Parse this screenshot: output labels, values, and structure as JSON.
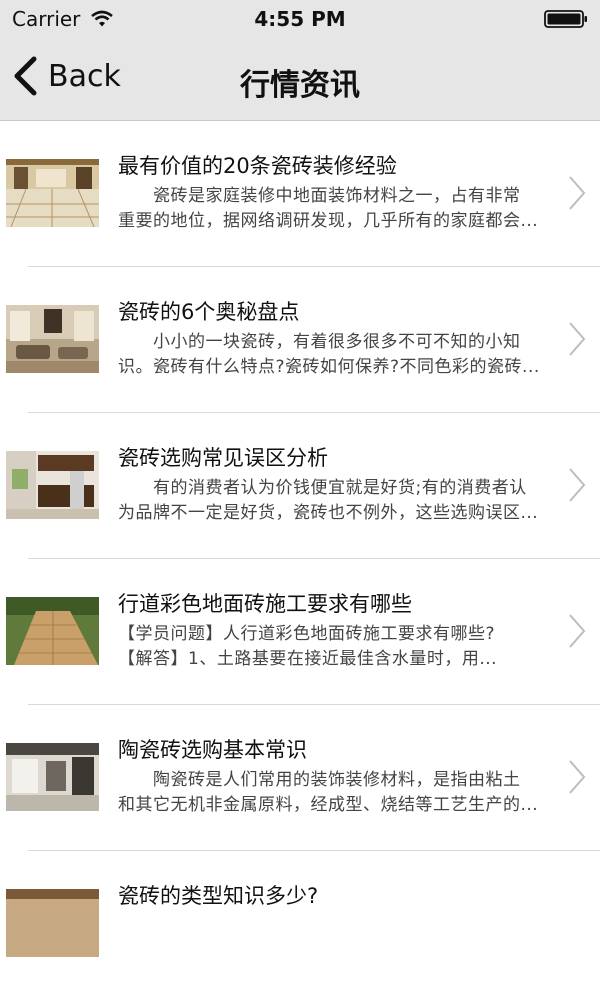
{
  "status": {
    "carrier": "Carrier",
    "time": "4:55 PM"
  },
  "nav": {
    "back_label": "Back",
    "title": "行情资讯"
  },
  "articles": [
    {
      "title": "最有价值的20条瓷砖装修经验",
      "line1": "　　瓷砖是家庭装修中地面装饰材料之一，占有非常",
      "line2": "重要的地位，据网络调研发现，几乎所有的家庭都会..."
    },
    {
      "title": "瓷砖的6个奥秘盘点",
      "line1": "　　小小的一块瓷砖，有着很多很多不可不知的小知",
      "line2": "识。瓷砖有什么特点?瓷砖如何保养?不同色彩的瓷砖..."
    },
    {
      "title": "瓷砖选购常见误区分析",
      "line1": "　　有的消费者认为价钱便宜就是好货;有的消费者认",
      "line2": "为品牌不一定是好货，瓷砖也不例外，这些选购误区..."
    },
    {
      "title": "行道彩色地面砖施工要求有哪些",
      "line1": "【学员问题】人行道彩色地面砖施工要求有哪些?",
      "line2": "【解答】1、土路基要在接近最佳含水量时，用..."
    },
    {
      "title": "陶瓷砖选购基本常识",
      "line1": "　　陶瓷砖是人们常用的装饰装修材料，是指由粘土",
      "line2": "和其它无机非金属原料，经成型、烧结等工艺生产的..."
    },
    {
      "title": "瓷砖的类型知识多少?",
      "line1": "",
      "line2": ""
    }
  ]
}
